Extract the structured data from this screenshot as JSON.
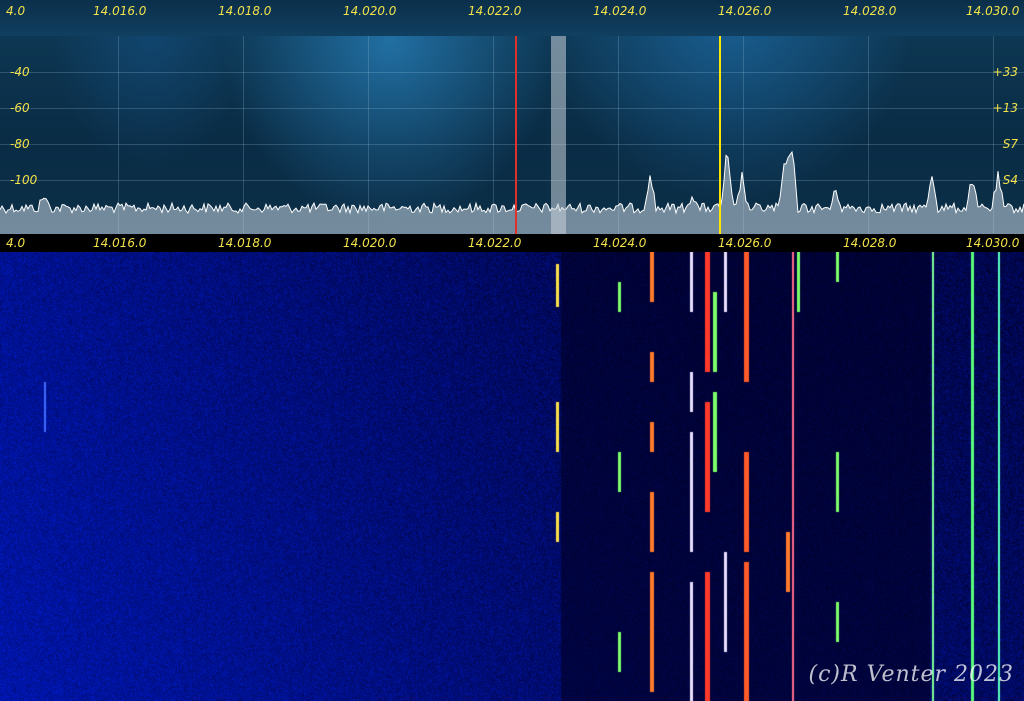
{
  "top_scale": [
    "4.0",
    "14.016.0",
    "14.018.0",
    "14.020.0",
    "14.022.0",
    "14.024.0",
    "14.026.0",
    "14.028.0",
    "14.030.0"
  ],
  "bottom_scale": [
    "4.0",
    "14.016.0",
    "14.018.0",
    "14.020.0",
    "14.022.0",
    "14.024.0",
    "14.026.0",
    "14.028.0",
    "14.030.0"
  ],
  "db_labels": [
    "-40",
    "-60",
    "-80",
    "-100"
  ],
  "s_labels": [
    "+33",
    "+13",
    "S7",
    "S4"
  ],
  "colors": {
    "freq_label": "#f3e24a",
    "spectrum_trace": "#ffffff",
    "marker_red": "#e0302a",
    "marker_yellow": "#ffe600",
    "passband": "#c9d2d8"
  },
  "copyright": "(c)R Venter 2023"
}
